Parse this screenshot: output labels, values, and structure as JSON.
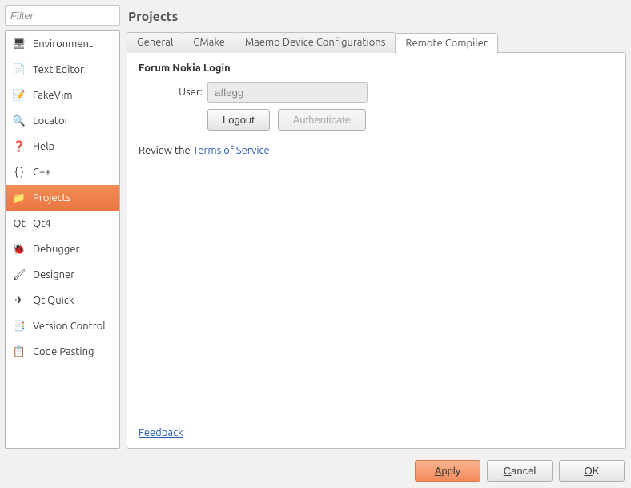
{
  "sidebar": {
    "filter_placeholder": "Filter",
    "items": [
      {
        "label": "Environment",
        "icon": "monitor-icon"
      },
      {
        "label": "Text Editor",
        "icon": "document-icon"
      },
      {
        "label": "FakeVim",
        "icon": "fakevim-icon"
      },
      {
        "label": "Locator",
        "icon": "locator-icon"
      },
      {
        "label": "Help",
        "icon": "help-icon"
      },
      {
        "label": "C++",
        "icon": "cpp-icon"
      },
      {
        "label": "Projects",
        "icon": "folder-icon",
        "selected": true
      },
      {
        "label": "Qt4",
        "icon": "qt-icon"
      },
      {
        "label": "Debugger",
        "icon": "bug-icon"
      },
      {
        "label": "Designer",
        "icon": "brush-icon"
      },
      {
        "label": "Qt Quick",
        "icon": "paperplane-icon"
      },
      {
        "label": "Version Control",
        "icon": "vcs-icon"
      },
      {
        "label": "Code Pasting",
        "icon": "clipboard-icon"
      }
    ]
  },
  "main": {
    "title": "Projects",
    "tabs": [
      {
        "label": "General"
      },
      {
        "label": "CMake"
      },
      {
        "label": "Maemo Device Configurations"
      },
      {
        "label": "Remote Compiler",
        "active": true
      }
    ],
    "section_title": "Forum Nokia Login",
    "user_label": "User:",
    "user_value": "aflegg",
    "logout_label": "Logout",
    "authenticate_label": "Authenticate",
    "review_prefix": "Review the ",
    "tos_link": "Terms of Service",
    "feedback_link": "Feedback"
  },
  "footer": {
    "apply": "Apply",
    "cancel": "Cancel",
    "ok": "OK"
  },
  "icons": {
    "monitor-icon": "🖥",
    "document-icon": "📄",
    "fakevim-icon": "📝",
    "locator-icon": "🔍",
    "help-icon": "❓",
    "cpp-icon": "{ }",
    "folder-icon": "📁",
    "qt-icon": "Qt",
    "bug-icon": "🐞",
    "brush-icon": "🖌",
    "paperplane-icon": "✈",
    "vcs-icon": "📑",
    "clipboard-icon": "📋"
  }
}
